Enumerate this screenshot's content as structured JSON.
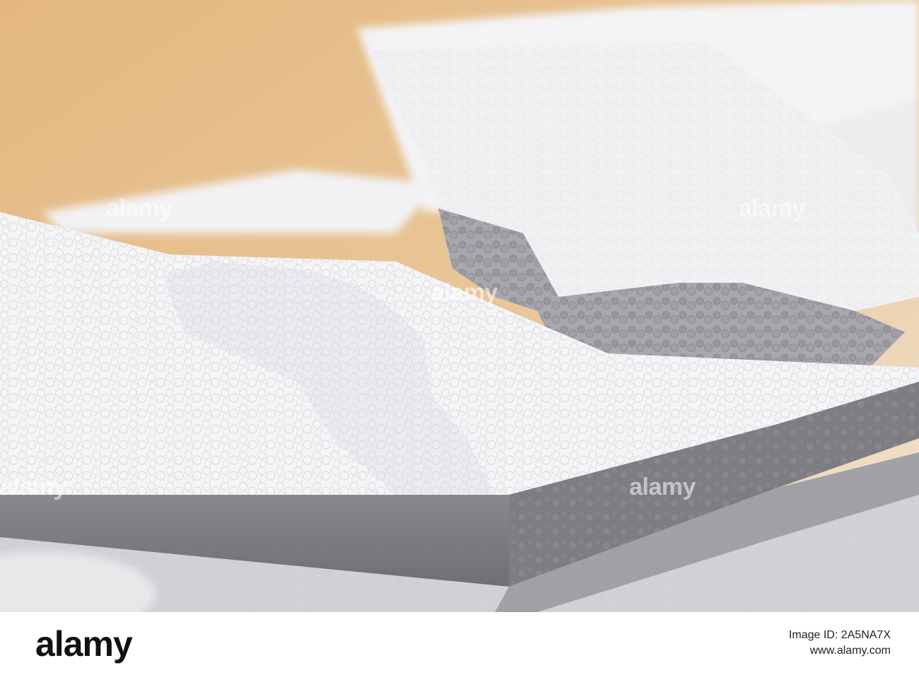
{
  "photo": {
    "subject": "polystyrene-foam-sheets",
    "palette": {
      "background": "#e8bc84",
      "foam": "#f1f1f3",
      "shadow": "#7b7b80"
    }
  },
  "watermark": {
    "text": "alamy"
  },
  "footer": {
    "brand": "alamy",
    "image_id_line": "Image ID: 2A5NA7X",
    "site_line": "www.alamy.com"
  }
}
